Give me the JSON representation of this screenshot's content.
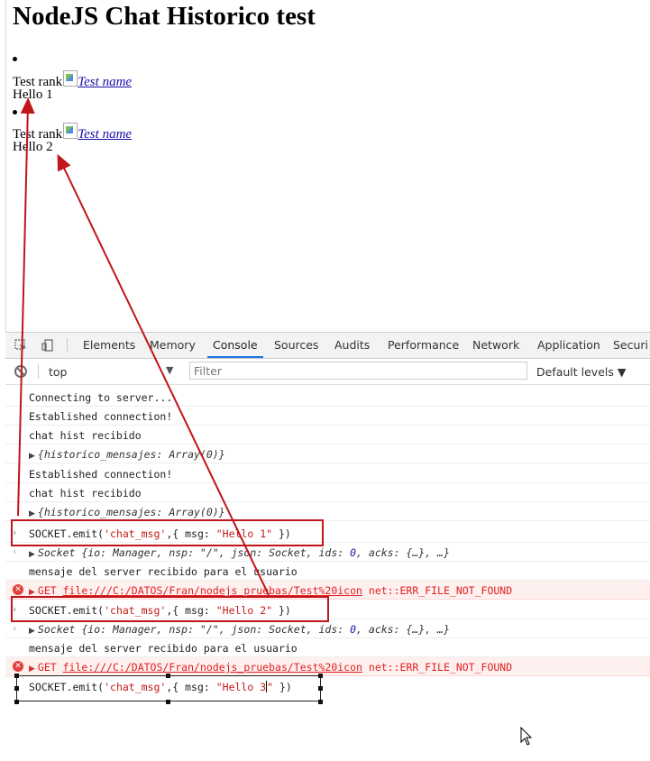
{
  "page": {
    "title": "NodeJS Chat Historico test",
    "messages": [
      {
        "rank": "Test rank",
        "name": "Test name",
        "text": "Hello 1"
      },
      {
        "rank": "Test rank",
        "name": "Test name",
        "text": "Hello 2"
      }
    ]
  },
  "devtools": {
    "tabs": [
      "Elements",
      "Memory",
      "Console",
      "Sources",
      "Audits",
      "Performance",
      "Network",
      "Application",
      "Securi"
    ],
    "active_tab": "Console",
    "context": "top",
    "filter_placeholder": "Filter",
    "levels": "Default levels"
  },
  "console": {
    "lines": {
      "l1": "Connecting to server...",
      "l2": "Established connection!",
      "l3": "chat hist recibido",
      "l4": "{historico_mensajes: Array(0)}",
      "l5": "Established connection!",
      "l6": "chat hist recibido",
      "l7": "{historico_mensajes: Array(0)}",
      "cmd1_a": "SOCKET.emit(",
      "cmd1_b": "'chat_msg'",
      "cmd1_c": ",{ msg: ",
      "cmd1_d": "\"Hello 1\"",
      "cmd1_e": " })",
      "ret1_a": "Socket {io: Manager, nsp: \"/\", json: Socket, ids: ",
      "ret1_num": "0",
      "ret1_b": ", acks: {…}, …}",
      "srv1": "mensaje del server recibido para el usuario",
      "err1_a": "GET ",
      "err1_url": "file:///C:/DATOS/Fran/nodejs_pruebas/Test%20icon",
      "err1_b": " net::ERR_FILE_NOT_FOUND",
      "cmd2_d": "\"Hello 2\"",
      "ret2_a": "Socket {io: Manager, nsp: \"/\", json: Socket, ids: ",
      "ret2_num": "0",
      "ret2_b": ", acks: {…}, …}",
      "srv2": "mensaje del server recibido para el usuario",
      "err2_a": "GET ",
      "err2_url": "file:///C:/DATOS/Fran/nodejs_pruebas/Test%20icon",
      "err2_b": " net::ERR_FILE_NOT_FOUND",
      "cmd3_d": "\"Hello 3",
      "cmd3_q": "\"",
      "cmd3_e": " })"
    }
  },
  "colors": {
    "annotation_red": "#c0151b",
    "link": "#1a0dab",
    "error_text": "#e02020",
    "string": "#c41a16"
  }
}
